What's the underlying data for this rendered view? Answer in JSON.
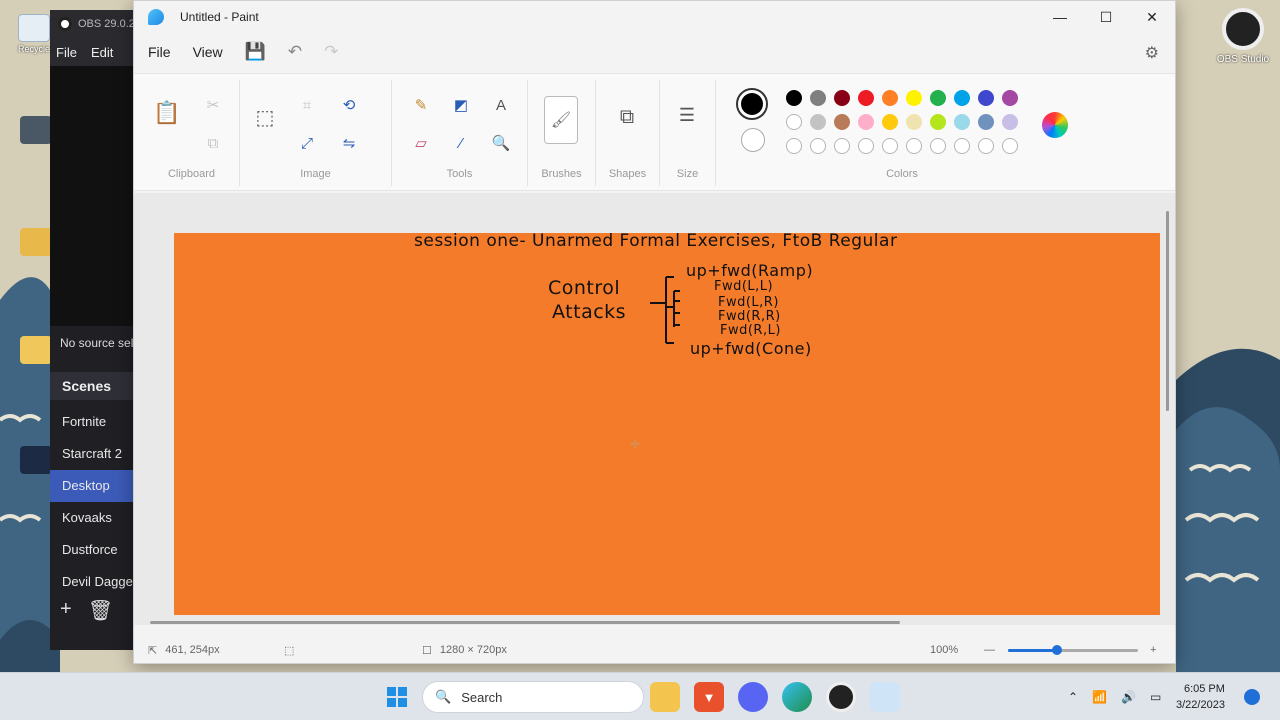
{
  "desktop": {
    "icons": [
      {
        "label": "Recycle"
      },
      {
        "label": ""
      },
      {
        "label": ""
      },
      {
        "label": ""
      },
      {
        "label": ""
      }
    ],
    "obs_shortcut_label": "OBS Studio"
  },
  "obs": {
    "title": "OBS 29.0.2",
    "menu": [
      "File",
      "Edit"
    ],
    "no_source": "No source selected",
    "scenes_header": "Scenes",
    "scenes": [
      "Fortnite",
      "Starcraft 2",
      "Desktop",
      "Kovaaks",
      "Dustforce",
      "Devil Daggers"
    ],
    "active_scene": "Desktop"
  },
  "paint": {
    "title": "Untitled - Paint",
    "menu": {
      "file": "File",
      "view": "View"
    },
    "groups": {
      "clipboard": "Clipboard",
      "image": "Image",
      "tools": "Tools",
      "brushes": "Brushes",
      "shapes": "Shapes",
      "size": "Size",
      "colors": "Colors"
    },
    "palette_row1": [
      "#000000",
      "#7f7f7f",
      "#880015",
      "#ed1c24",
      "#ff7f27",
      "#fff200",
      "#22b14c",
      "#00a2e8",
      "#3f48cc",
      "#a349a4"
    ],
    "palette_row2": [
      "#ffffff",
      "#c3c3c3",
      "#b97a57",
      "#ffaec9",
      "#ffc90e",
      "#efe4b0",
      "#b5e61d",
      "#99d9ea",
      "#7092be",
      "#c8bfe7"
    ],
    "primary_color": "#000000",
    "secondary_color": "#ffffff",
    "canvas_color": "#f47b2a",
    "drawing": {
      "heading": "session one- Unarmed Formal Exercises, FtoB Regular",
      "left_label_1": "Control",
      "left_label_2": "Attacks",
      "items": [
        "up+fwd(Ramp)",
        "Fwd(L,L)",
        "Fwd(L,R)",
        "Fwd(R,R)",
        "Fwd(R,L)",
        "up+fwd(Cone)"
      ]
    },
    "status": {
      "cursor": "461, 254px",
      "canvas_size": "1280 × 720px",
      "zoom": "100%",
      "zoom_level": 0.38
    }
  },
  "taskbar": {
    "search_label": "Search",
    "time": "6:05 PM",
    "date": "3/22/2023"
  }
}
